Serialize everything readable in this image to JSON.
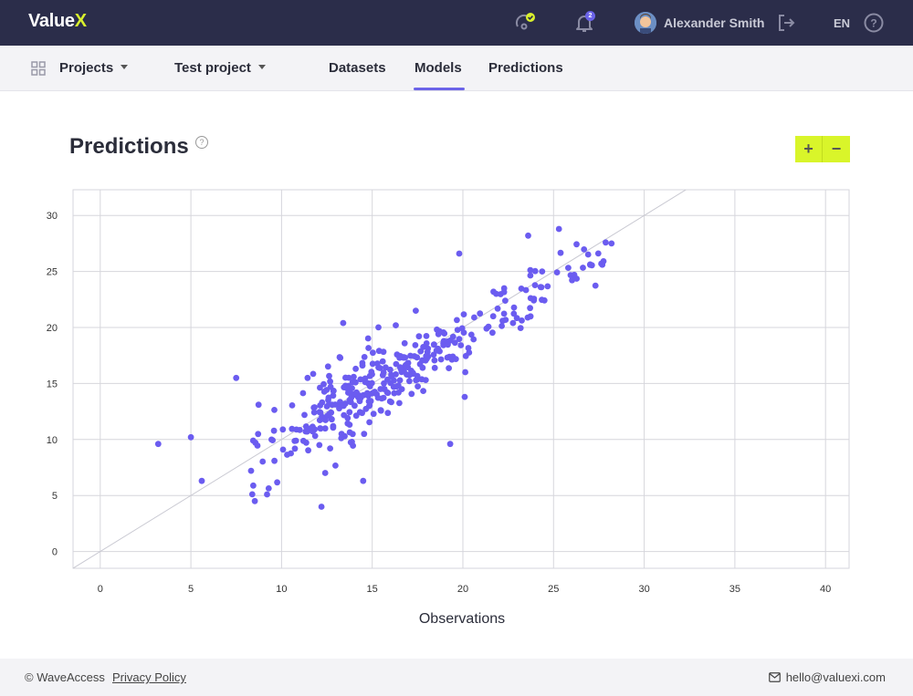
{
  "app": {
    "logo_main": "Value",
    "logo_accent": "X"
  },
  "topbar": {
    "user_name": "Alexander Smith",
    "language": "EN",
    "notification_count": "2",
    "icons": [
      "status-check-icon",
      "bell-icon",
      "logout-icon",
      "help-icon"
    ]
  },
  "subnav": {
    "projects_label": "Projects",
    "project_label": "Test project",
    "tabs": [
      {
        "label": "Datasets",
        "active": false
      },
      {
        "label": "Models",
        "active": true
      },
      {
        "label": "Predictions",
        "active": false
      }
    ]
  },
  "page": {
    "title": "Predictions",
    "zoom_in": "+",
    "zoom_out": "−"
  },
  "colors": {
    "accent": "#6b63e8",
    "point": "#6b5cf0",
    "highlight": "#d9f52a",
    "dark": "#2b2d4a"
  },
  "chart_data": {
    "type": "scatter",
    "xlabel": "Observations",
    "ylabel": "",
    "xlim": [
      -1.5,
      41.3
    ],
    "ylim": [
      -1.5,
      32.3
    ],
    "x_ticks": [
      0,
      5,
      10,
      15,
      20,
      25,
      30,
      35,
      40
    ],
    "y_ticks": [
      0,
      5,
      10,
      15,
      20,
      25,
      30
    ],
    "grid": true,
    "reference_line": "y = x",
    "n_points": 375,
    "outliers": [
      {
        "x": 3.2,
        "y": 9.6
      },
      {
        "x": 5.0,
        "y": 10.2
      },
      {
        "x": 5.6,
        "y": 6.3
      },
      {
        "x": 7.5,
        "y": 15.5
      },
      {
        "x": 12.2,
        "y": 4.0
      },
      {
        "x": 13.4,
        "y": 20.4
      },
      {
        "x": 19.3,
        "y": 9.6
      },
      {
        "x": 19.8,
        "y": 26.6
      },
      {
        "x": 20.1,
        "y": 13.8
      },
      {
        "x": 25.3,
        "y": 28.8
      },
      {
        "x": 23.6,
        "y": 28.2
      },
      {
        "x": 28.2,
        "y": 27.5
      },
      {
        "x": 9.2,
        "y": 5.1
      },
      {
        "x": 14.5,
        "y": 6.3
      },
      {
        "x": 17.4,
        "y": 21.5
      },
      {
        "x": 16.3,
        "y": 20.2
      }
    ],
    "footer": {
      "copyright": "© WaveAccess",
      "privacy": "Privacy Policy",
      "email": "hello@valuexi.com"
    }
  }
}
